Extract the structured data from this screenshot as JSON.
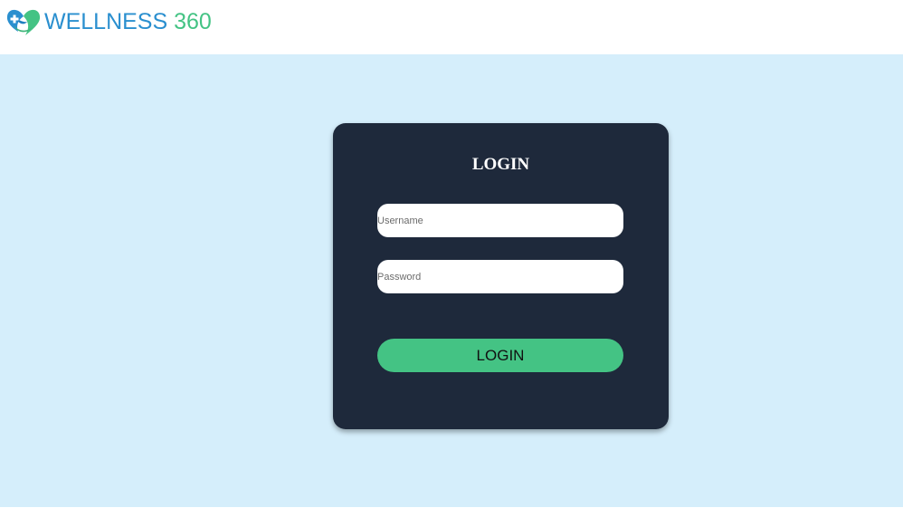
{
  "header": {
    "brand_word": "WELLNESS",
    "brand_number": "360",
    "logo_icon": "heart-hands-icon"
  },
  "login": {
    "title": "LOGIN",
    "username_placeholder": "Username",
    "password_placeholder": "Password",
    "button_label": "LOGIN"
  },
  "colors": {
    "background": "#d5eefb",
    "card": "#1e293b",
    "accent_green": "#44c384",
    "brand_blue": "#2a8fcf"
  }
}
